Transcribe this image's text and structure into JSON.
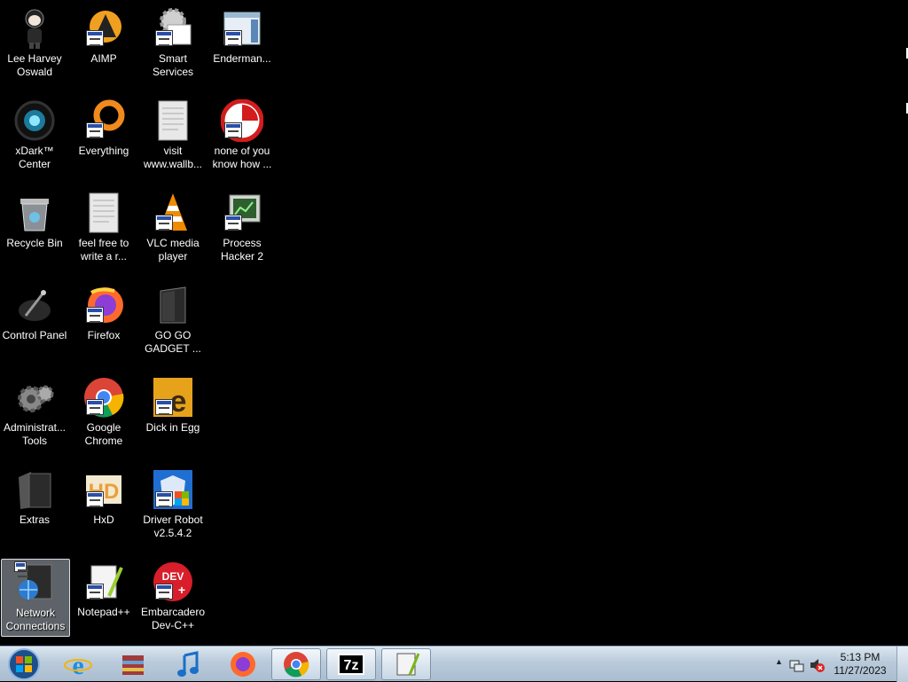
{
  "desktop": {
    "icons": [
      {
        "label": "Lee Harvey\nOswald",
        "icon": "character-figure-icon"
      },
      {
        "label": "xDark™\nCenter",
        "icon": "xdark-orb-icon"
      },
      {
        "label": "Recycle Bin",
        "icon": "recycle-bin-icon"
      },
      {
        "label": "Control Panel",
        "icon": "control-panel-icon"
      },
      {
        "label": "Administrat...\nTools",
        "icon": "admin-tools-icon"
      },
      {
        "label": "Extras",
        "icon": "folder-icon"
      },
      {
        "label": "Network\nConnections",
        "icon": "network-icon"
      },
      {
        "label": "AIMP",
        "icon": "aimp-icon"
      },
      {
        "label": "Everything",
        "icon": "everything-icon"
      },
      {
        "label": "feel free to\nwrite a r...",
        "icon": "text-document-icon"
      },
      {
        "label": "Firefox",
        "icon": "firefox-icon"
      },
      {
        "label": "Google\nChrome",
        "icon": "chrome-icon"
      },
      {
        "label": "HxD",
        "icon": "hxd-icon"
      },
      {
        "label": "Notepad++",
        "icon": "notepad-plus-plus-icon"
      },
      {
        "label": "Smart\nServices",
        "icon": "gear-icon"
      },
      {
        "label": "visit\nwww.wallb...",
        "icon": "text-document-icon"
      },
      {
        "label": "VLC media\nplayer",
        "icon": "vlc-cone-icon"
      },
      {
        "label": "GO GO\nGADGET ...",
        "icon": "dark-folder-icon"
      },
      {
        "label": "Dick in Egg",
        "icon": "egg-app-icon"
      },
      {
        "label": "Driver Robot\nv2.5.4.2",
        "icon": "shield-app-icon"
      },
      {
        "label": "Embarcadero\nDev-C++",
        "icon": "dev-cpp-icon"
      },
      {
        "label": "Enderman...",
        "icon": "window-app-icon"
      },
      {
        "label": "none of you\nknow how ...",
        "icon": "red-circle-app-icon"
      },
      {
        "label": "Process\nHacker 2",
        "icon": "process-hacker-icon"
      }
    ]
  },
  "taskbar": {
    "start": "start-orb-icon",
    "pinned": [
      {
        "icon": "internet-explorer-icon"
      },
      {
        "icon": "archive-icon"
      },
      {
        "icon": "music-note-icon"
      },
      {
        "icon": "firefox-icon"
      },
      {
        "icon": "chrome-icon"
      },
      {
        "icon": "seven-zip-icon",
        "text": "7z"
      },
      {
        "icon": "notepad-plus-plus-icon"
      }
    ],
    "tray": {
      "time": "5:13 PM",
      "date": "11/27/2023",
      "show_hidden": "▲"
    }
  },
  "colors": {
    "desktop_bg": "#000000",
    "taskbar": "#b9cadb",
    "selection": "#aab4be"
  }
}
